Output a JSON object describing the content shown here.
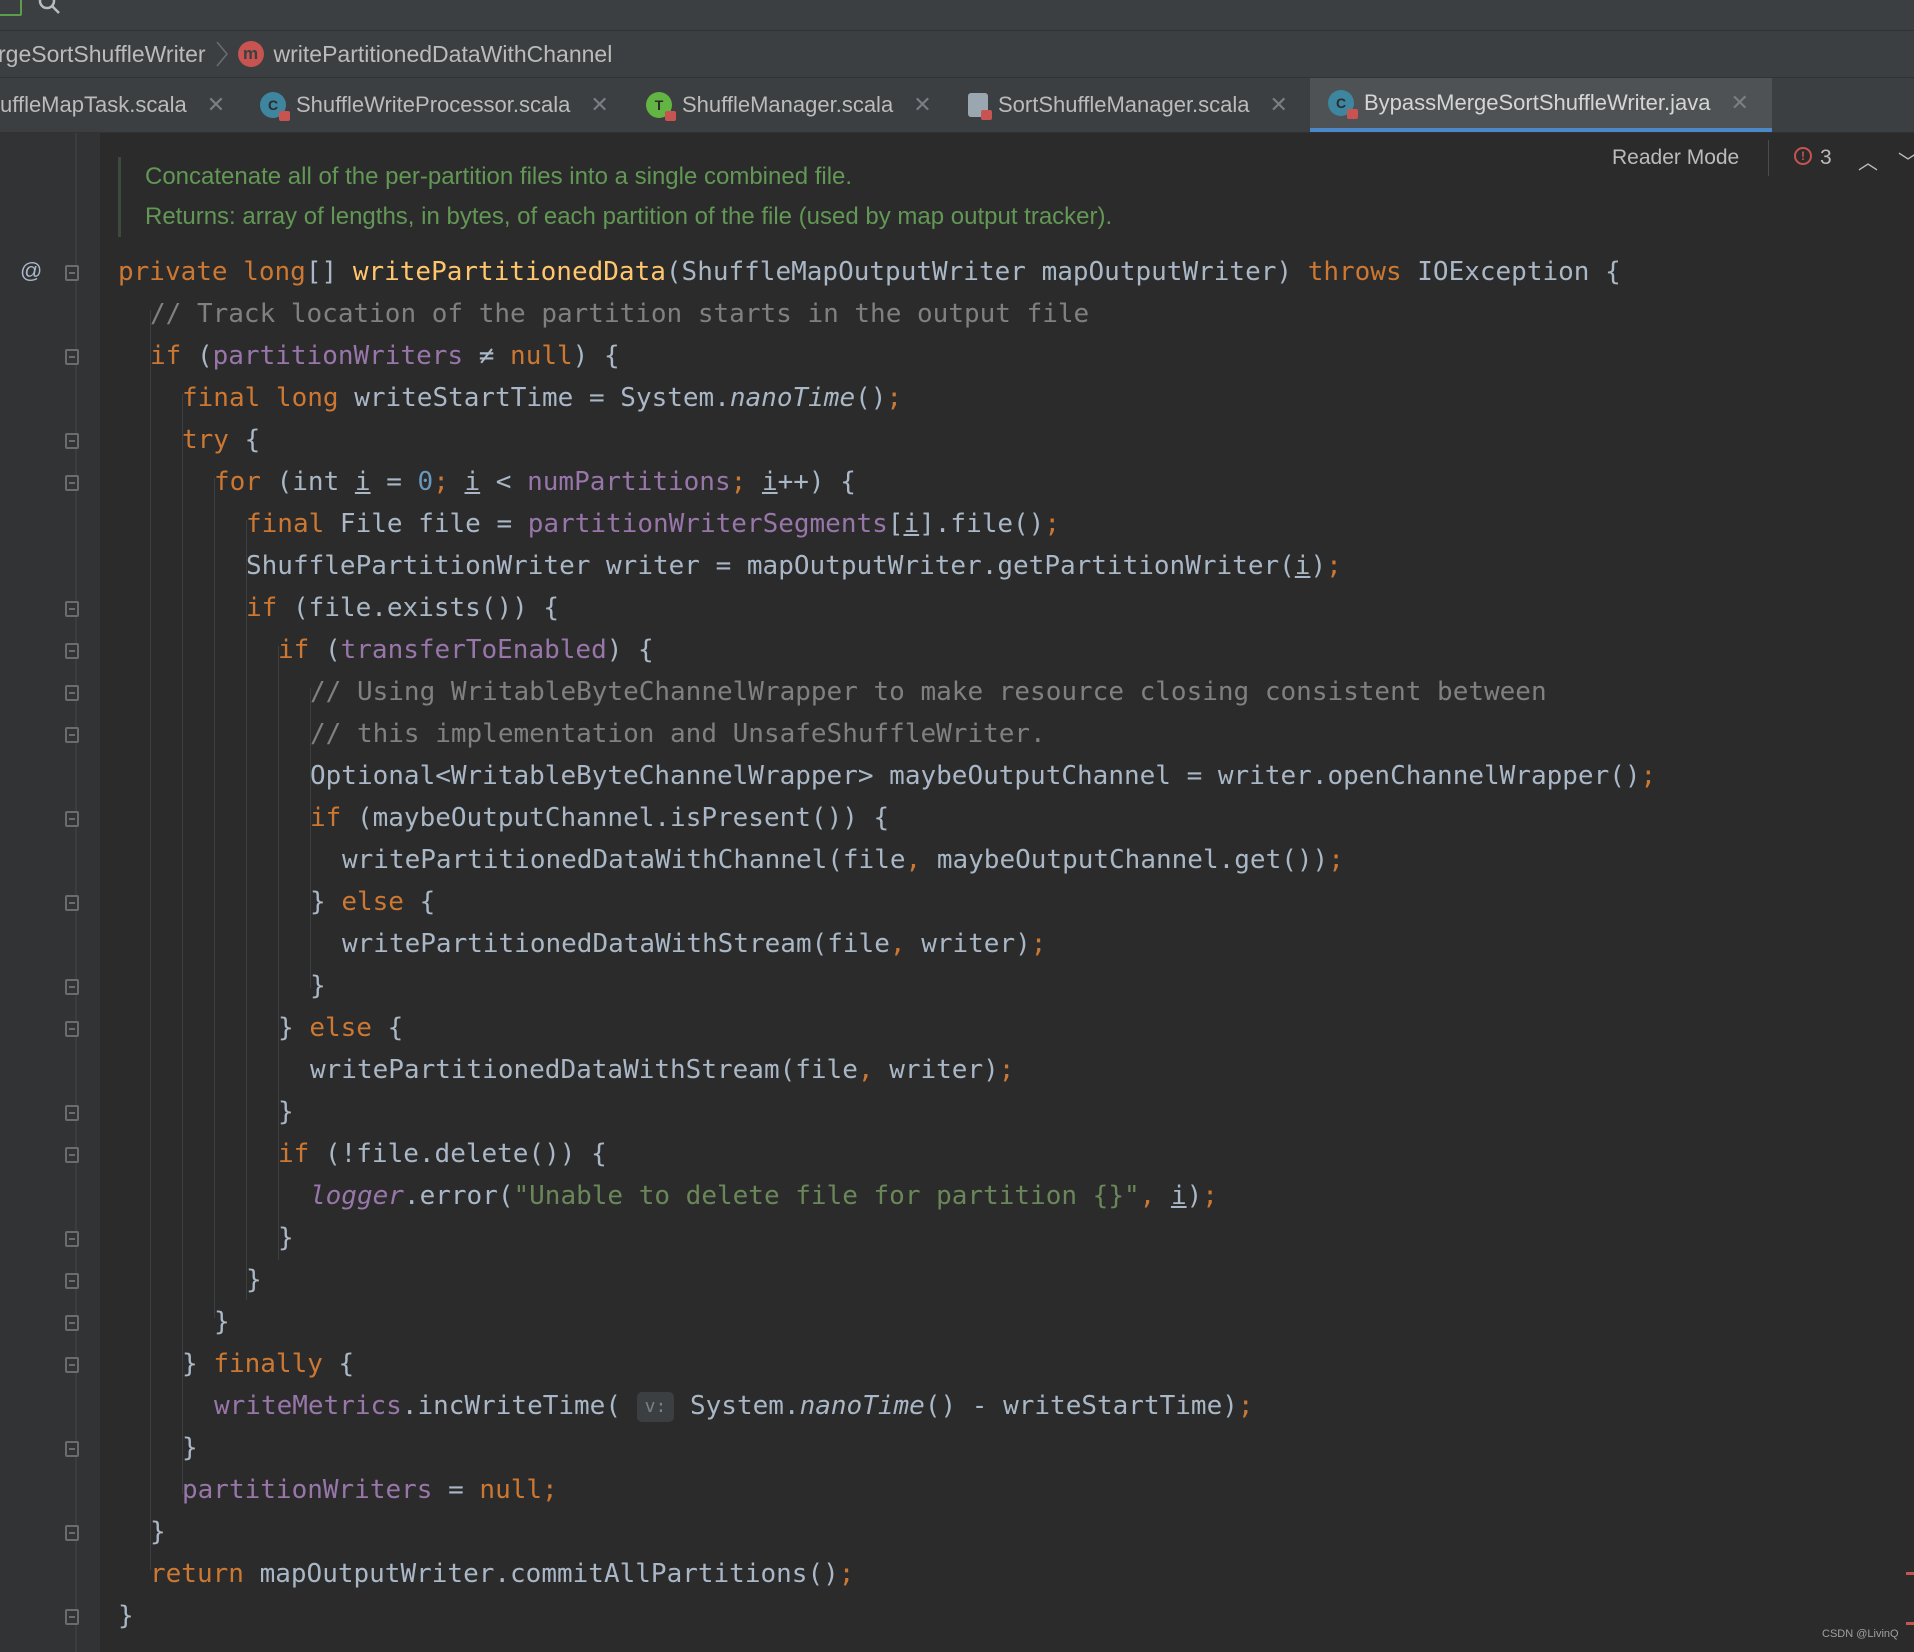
{
  "breadcrumb": {
    "class_name": "rgeSortShuffleWriter",
    "method_icon": "m",
    "method_name": "writePartitionedDataWithChannel"
  },
  "tabs": [
    {
      "label": "uffleMapTask.scala",
      "icon": "scala-object-icon"
    },
    {
      "label": "ShuffleWriteProcessor.scala",
      "icon": "class-icon"
    },
    {
      "label": "ShuffleManager.scala",
      "icon": "trait-icon"
    },
    {
      "label": "SortShuffleManager.scala",
      "icon": "scala-object-icon"
    },
    {
      "label": "BypassMergeSortShuffleWriter.java",
      "icon": "class-icon",
      "active": true
    }
  ],
  "editor": {
    "reader_mode": "Reader Mode",
    "error_count": "3",
    "doc_comment": [
      "Concatenate all of the per-partition files into a single combined file.",
      "Returns: array of lengths, in bytes, of each partition of the file (used by map output tracker)."
    ],
    "gutter_annotation": "@",
    "hint_label": "v:"
  },
  "colors": {
    "keyword": "#cc7832",
    "method": "#ffc66d",
    "field": "#9876aa",
    "comment": "#808080",
    "number": "#6897bb",
    "string": "#6a8759",
    "text": "#a9b7c6",
    "doc": "#629755",
    "tab_active": "#4a88c7",
    "error": "#c75450"
  },
  "code": {
    "l1": {
      "a": "private long",
      "b": "[] ",
      "c": "writePartitionedData",
      "d": "(ShuffleMapOutputWriter mapOutputWriter) ",
      "e": "throws ",
      "f": "IOException {"
    },
    "l2": {
      "a": "// Track location of the partition starts in the output file"
    },
    "l3": {
      "a": "if ",
      "b": "(",
      "c": "partitionWriters",
      "d": " ≠ ",
      "e": "null",
      "f": ") {"
    },
    "l4": {
      "a": "final long ",
      "b": "writeStartTime = System.",
      "c": "nanoTime",
      "d": "()",
      "e": ";"
    },
    "l5": {
      "a": "try ",
      "b": "{"
    },
    "l6": {
      "a": "for ",
      "b": "(int ",
      "c": "i",
      "d": " = ",
      "e": "0",
      "f": "; ",
      "g": "i",
      "h": " < ",
      "i": "numPartitions",
      "j": "; ",
      "k": "i",
      "l": "++) {"
    },
    "l7": {
      "a": "final ",
      "b": "File file = ",
      "c": "partitionWriterSegments",
      "d": "[",
      "e": "i",
      "f": "].file()",
      "g": ";"
    },
    "l8": {
      "a": "ShufflePartitionWriter writer = mapOutputWriter.getPartitionWriter(",
      "b": "i",
      "c": ")",
      "d": ";"
    },
    "l9": {
      "a": "if ",
      "b": "(file.exists()) {"
    },
    "l10": {
      "a": "if ",
      "b": "(",
      "c": "transferToEnabled",
      "d": ") {"
    },
    "l11": {
      "a": "// Using WritableByteChannelWrapper to make resource closing consistent between"
    },
    "l12": {
      "a": "// this implementation and UnsafeShuffleWriter."
    },
    "l13": {
      "a": "Optional<WritableByteChannelWrapper> maybeOutputChannel = writer.openChannelWrapper()",
      "b": ";"
    },
    "l14": {
      "a": "if ",
      "b": "(maybeOutputChannel.isPresent()) {"
    },
    "l15": {
      "a": "writePartitionedDataWithChannel(file",
      "b": ", ",
      "c": "maybeOutputChannel.get())",
      "d": ";"
    },
    "l16": {
      "a": "} ",
      "b": "else ",
      "c": "{"
    },
    "l17": {
      "a": "writePartitionedDataWithStream(file",
      "b": ", ",
      "c": "writer)",
      "d": ";"
    },
    "l18": {
      "a": "}"
    },
    "l19": {
      "a": "} ",
      "b": "else ",
      "c": "{"
    },
    "l20": {
      "a": "writePartitionedDataWithStream(file",
      "b": ", ",
      "c": "writer)",
      "d": ";"
    },
    "l21": {
      "a": "}"
    },
    "l22": {
      "a": "if ",
      "b": "(!file.delete()) {"
    },
    "l23": {
      "a": "logger",
      "b": ".error(",
      "c": "\"Unable to delete file for partition {}\"",
      "d": ", ",
      "e": "i",
      "f": ")",
      "g": ";"
    },
    "l24": {
      "a": "}"
    },
    "l25": {
      "a": "}"
    },
    "l26": {
      "a": "}"
    },
    "l27": {
      "a": "} ",
      "b": "finally ",
      "c": "{"
    },
    "l28": {
      "a": "writeMetrics",
      "b": ".incWriteTime( ",
      "c": "v:",
      "d": " System.",
      "e": "nanoTime",
      "f": "() - writeStartTime)",
      "g": ";"
    },
    "l29": {
      "a": "}"
    },
    "l30": {
      "a": "partitionWriters",
      "b": " = ",
      "c": "null",
      "d": ";"
    },
    "l31": {
      "a": "}"
    },
    "l32": {
      "a": "return ",
      "b": "mapOutputWriter.commitAllPartitions()",
      "c": ";"
    },
    "l33": {
      "a": "}"
    }
  },
  "watermark": "CSDN @LivinQ"
}
